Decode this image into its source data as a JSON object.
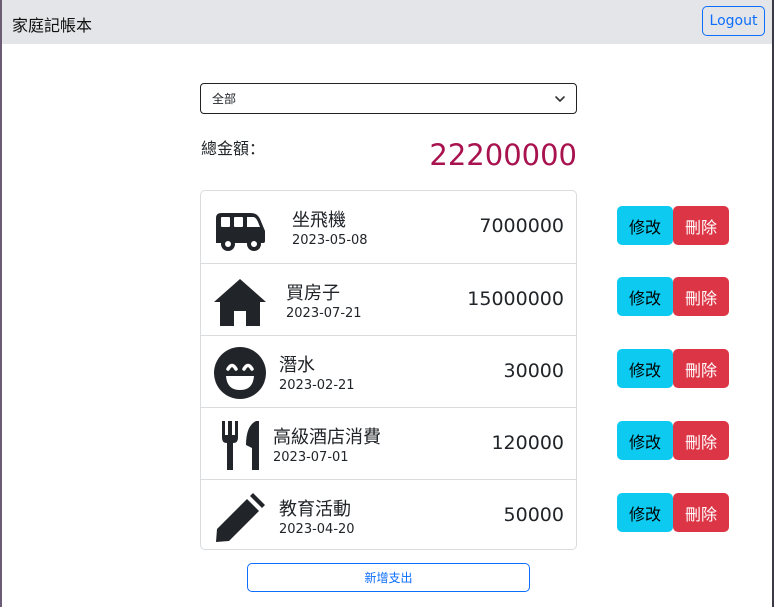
{
  "app": {
    "title": "家庭記帳本",
    "logout_label": "Logout"
  },
  "filter": {
    "selected": "全部"
  },
  "summary": {
    "label": "總金額：",
    "total": "22200000"
  },
  "expenses": [
    {
      "icon": "bus-icon",
      "name": "坐飛機",
      "date": "2023-05-08",
      "amount": "7000000",
      "edit_label": "修改",
      "delete_label": "刪除"
    },
    {
      "icon": "house-icon",
      "name": "買房子",
      "date": "2023-07-21",
      "amount": "15000000",
      "edit_label": "修改",
      "delete_label": "刪除"
    },
    {
      "icon": "smile-icon",
      "name": "潛水",
      "date": "2023-02-21",
      "amount": "30000",
      "edit_label": "修改",
      "delete_label": "刪除"
    },
    {
      "icon": "utensils-icon",
      "name": "高級酒店消費",
      "date": "2023-07-01",
      "amount": "120000",
      "edit_label": "修改",
      "delete_label": "刪除"
    },
    {
      "icon": "pencil-icon",
      "name": "教育活動",
      "date": "2023-04-20",
      "amount": "50000",
      "edit_label": "修改",
      "delete_label": "刪除"
    }
  ],
  "add_button_label": "新增支出",
  "colors": {
    "primary": "#0d6efd",
    "info": "#0dcaf0",
    "danger": "#dc3545",
    "total": "#a8124f",
    "navbar": "#e4e5e8"
  }
}
